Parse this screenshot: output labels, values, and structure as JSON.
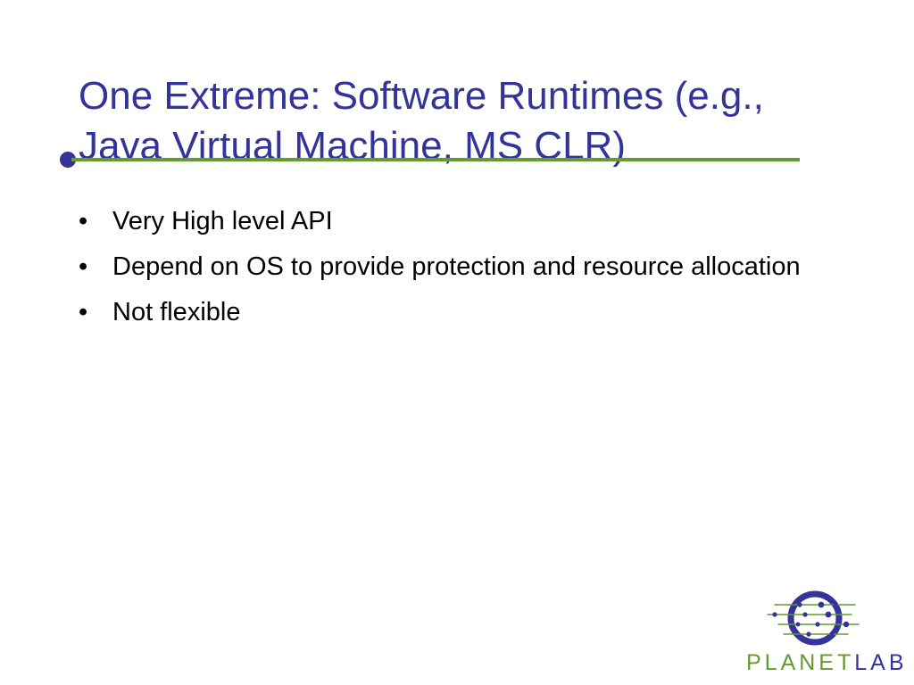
{
  "slide": {
    "title_line1": "One Extreme: Software Runtimes (e.g.,",
    "title_line2": "Java Virtual Machine, MS CLR)",
    "bullet_char": "•",
    "bullets": [
      "Very High level API",
      "Depend on OS to provide protection and resource allocation",
      "Not flexible"
    ]
  },
  "logo": {
    "text_part_a": "PLANET",
    "text_part_b": "LAB"
  },
  "colors": {
    "title": "#333399",
    "rule": "#669933",
    "logo_green": "#669933",
    "logo_blue": "#333399"
  }
}
